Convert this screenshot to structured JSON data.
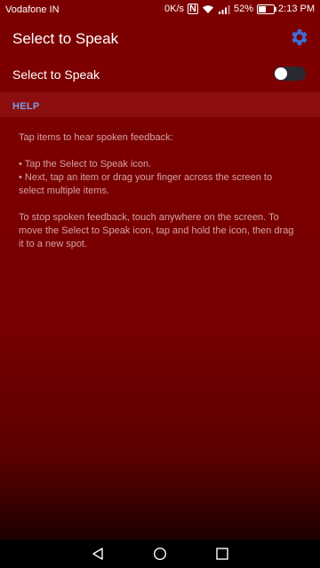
{
  "status_bar": {
    "carrier": "Vodafone IN",
    "speed": "0K/s",
    "nfc": "N",
    "battery_percent": "52%",
    "battery_level": 0.52,
    "time": "2:13 PM"
  },
  "toolbar": {
    "title": "Select to Speak",
    "settings_icon": "gear-icon"
  },
  "switch_row": {
    "label": "Select to Speak",
    "enabled": false
  },
  "help": {
    "header": "HELP",
    "intro": "Tap items to hear spoken feedback:",
    "bullet_1": "• Tap the Select to Speak icon.",
    "bullet_2": "• Next, tap an item or drag your finger across the screen to select multiple items.",
    "outro": "To stop spoken feedback, touch anywhere on the screen. To move the Select to Speak icon, tap and hold the icon, then drag it to a new spot."
  },
  "colors": {
    "background": "#7a0000",
    "accent": "#3b6fd6",
    "section_header_text": "#7a9fe8",
    "body_text": "#d4a2a2"
  },
  "navbar": {
    "back_icon": "back-triangle-icon",
    "home_icon": "home-circle-icon",
    "recent_icon": "recent-square-icon"
  }
}
